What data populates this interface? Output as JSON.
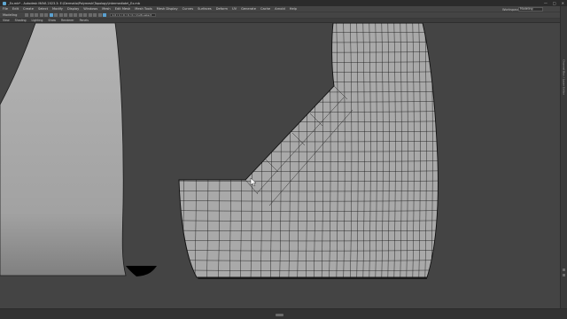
{
  "window": {
    "title": "_Ex.mb* - Autodesk MAYA 2023.3: E:\\Dermatio\\Polymesh\\Topology\\Intermediate\\_Ex.mb",
    "controls": [
      "—",
      "□",
      "✕"
    ]
  },
  "menus": [
    "File",
    "Edit",
    "Create",
    "Select",
    "Modify",
    "Display",
    "Windows",
    "Mesh",
    "Edit Mesh",
    "Mesh Tools",
    "Mesh Display",
    "Curves",
    "Surfaces",
    "Deform",
    "UV",
    "Generate",
    "Cache",
    "Arnold",
    "Help"
  ],
  "workspace": {
    "label": "Workspace:",
    "value": "Modeling"
  },
  "toolbar": {
    "labels": [
      "Modeling"
    ],
    "mode_field": "1.0 / 1 / 0 / 0 / 0 / multi-select"
  },
  "panel_menus": [
    "View",
    "Shading",
    "Lighting",
    "Show",
    "Renderer",
    "Panels"
  ],
  "side_strip": {
    "label": "Channel Box / Layer Editor"
  },
  "colors": {
    "background": "#444444",
    "surface": "#a9a9a9",
    "wire": "#1c1c1c",
    "shadow": "#000000"
  },
  "icons": [
    "maya-app-icon",
    "minimize-icon",
    "maximize-icon",
    "close-icon",
    "mouse-cursor-icon"
  ]
}
